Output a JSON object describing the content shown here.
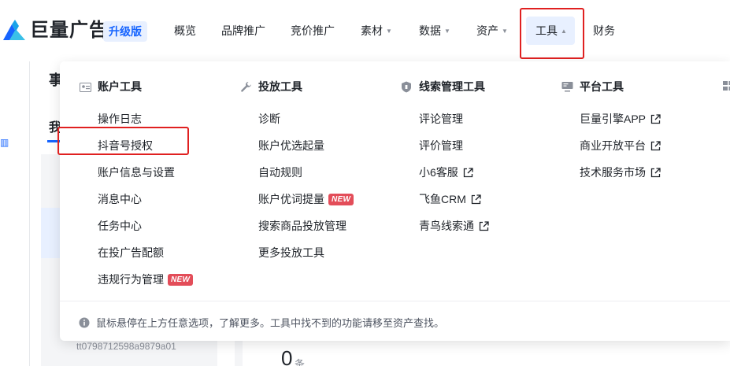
{
  "app": {
    "logo_text": "巨量广告",
    "edition_badge": "升级版"
  },
  "nav": {
    "items": [
      {
        "label": "概览",
        "caret": ""
      },
      {
        "label": "品牌推广",
        "caret": ""
      },
      {
        "label": "竞价推广",
        "caret": ""
      },
      {
        "label": "素材",
        "caret": "▼"
      },
      {
        "label": "数据",
        "caret": "▼"
      },
      {
        "label": "资产",
        "caret": "▼"
      },
      {
        "label": "工具",
        "caret": "▲",
        "active": true
      },
      {
        "label": "财务",
        "caret": ""
      }
    ]
  },
  "background": {
    "title_char": "事",
    "tab_char": "我",
    "account_id": "tt0798712598a9879a01",
    "count": "0",
    "count_unit": "条"
  },
  "dropdown": {
    "columns": [
      {
        "title": "账户工具",
        "icon": "account-tools-icon",
        "items": [
          {
            "label": "操作日志"
          },
          {
            "label": "抖音号授权",
            "highlighted": true
          },
          {
            "label": "账户信息与设置"
          },
          {
            "label": "消息中心"
          },
          {
            "label": "任务中心"
          },
          {
            "label": "在投广告配额"
          },
          {
            "label": "违规行为管理",
            "badge": "NEW"
          }
        ]
      },
      {
        "title": "投放工具",
        "icon": "wrench-icon",
        "items": [
          {
            "label": "诊断"
          },
          {
            "label": "账户优选起量"
          },
          {
            "label": "自动规则"
          },
          {
            "label": "账户优词提量",
            "badge": "NEW"
          },
          {
            "label": "搜索商品投放管理"
          },
          {
            "label": "更多投放工具"
          }
        ]
      },
      {
        "title": "线索管理工具",
        "icon": "shield-icon",
        "items": [
          {
            "label": "评论管理"
          },
          {
            "label": "评价管理"
          },
          {
            "label": "小6客服",
            "external": true
          },
          {
            "label": "飞鱼CRM",
            "external": true
          },
          {
            "label": "青鸟线索通",
            "external": true
          }
        ]
      },
      {
        "title": "平台工具",
        "icon": "monitor-icon",
        "items": [
          {
            "label": "巨量引擎APP",
            "external": true
          },
          {
            "label": "商业开放平台",
            "external": true
          },
          {
            "label": "技术服务市场",
            "external": true
          }
        ]
      }
    ],
    "footer_text": "鼠标悬停在上方任意选项，了解更多。工具中找不到的功能请移至资产查找。"
  },
  "colors": {
    "primary": "#1664ff",
    "highlight_border": "#e02020",
    "new_badge": "#e34d59"
  }
}
